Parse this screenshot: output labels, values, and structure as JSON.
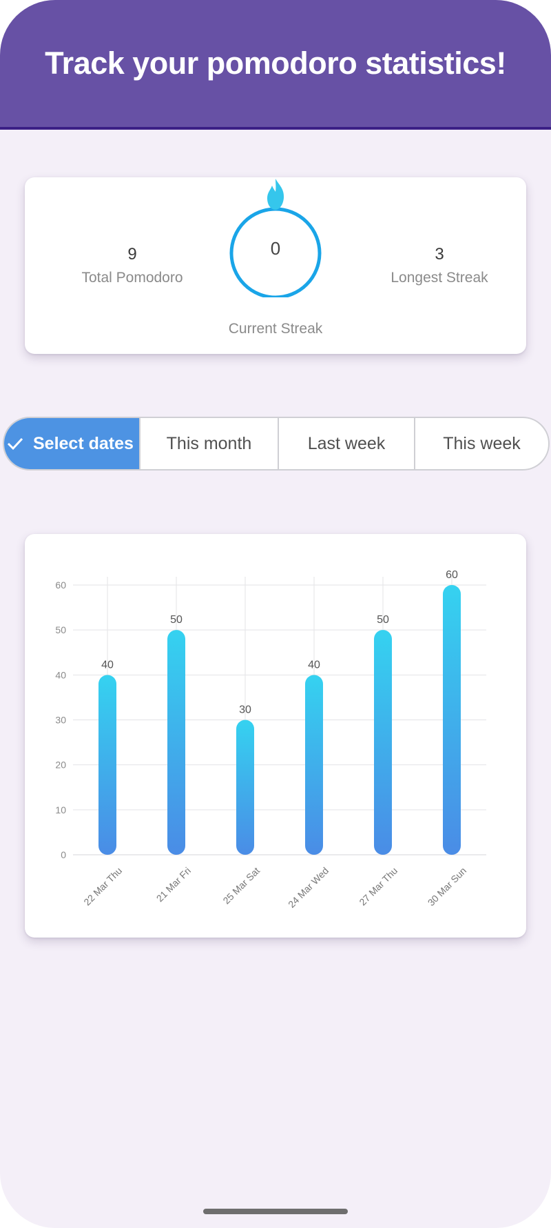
{
  "app_bar": {
    "title": "Track your pomodoro statistics!",
    "background": "#6751a5"
  },
  "stats": {
    "total": {
      "value": "9",
      "label": "Total Pomodoro"
    },
    "current_streak": {
      "value": "0",
      "label": "Current Streak",
      "icon": "flame-icon"
    },
    "longest_streak": {
      "value": "3",
      "label": "Longest Streak"
    }
  },
  "filters": {
    "items": [
      {
        "label": "Select dates",
        "selected": true,
        "icon": "check-icon"
      },
      {
        "label": "This month",
        "selected": false
      },
      {
        "label": "Last week",
        "selected": false
      },
      {
        "label": "This week",
        "selected": false
      }
    ],
    "accent": "#4d93e3"
  },
  "chart_data": {
    "type": "bar",
    "categories": [
      "22 Mar Thu",
      "21 Mar Fri",
      "25 Mar Sat",
      "24 Mar Wed",
      "27 Mar Thu",
      "30 Mar Sun"
    ],
    "values": [
      40,
      50,
      30,
      40,
      50,
      60
    ],
    "data_labels": [
      "40",
      "50",
      "30",
      "40",
      "50",
      "60"
    ],
    "yticks": [
      "0",
      "10",
      "20",
      "30",
      "40",
      "50",
      "60"
    ],
    "ylim": [
      0,
      60
    ],
    "grid": true,
    "bar_gradient": [
      "#35d2f0",
      "#4a8ce6"
    ],
    "title": "",
    "xlabel": "",
    "ylabel": ""
  }
}
